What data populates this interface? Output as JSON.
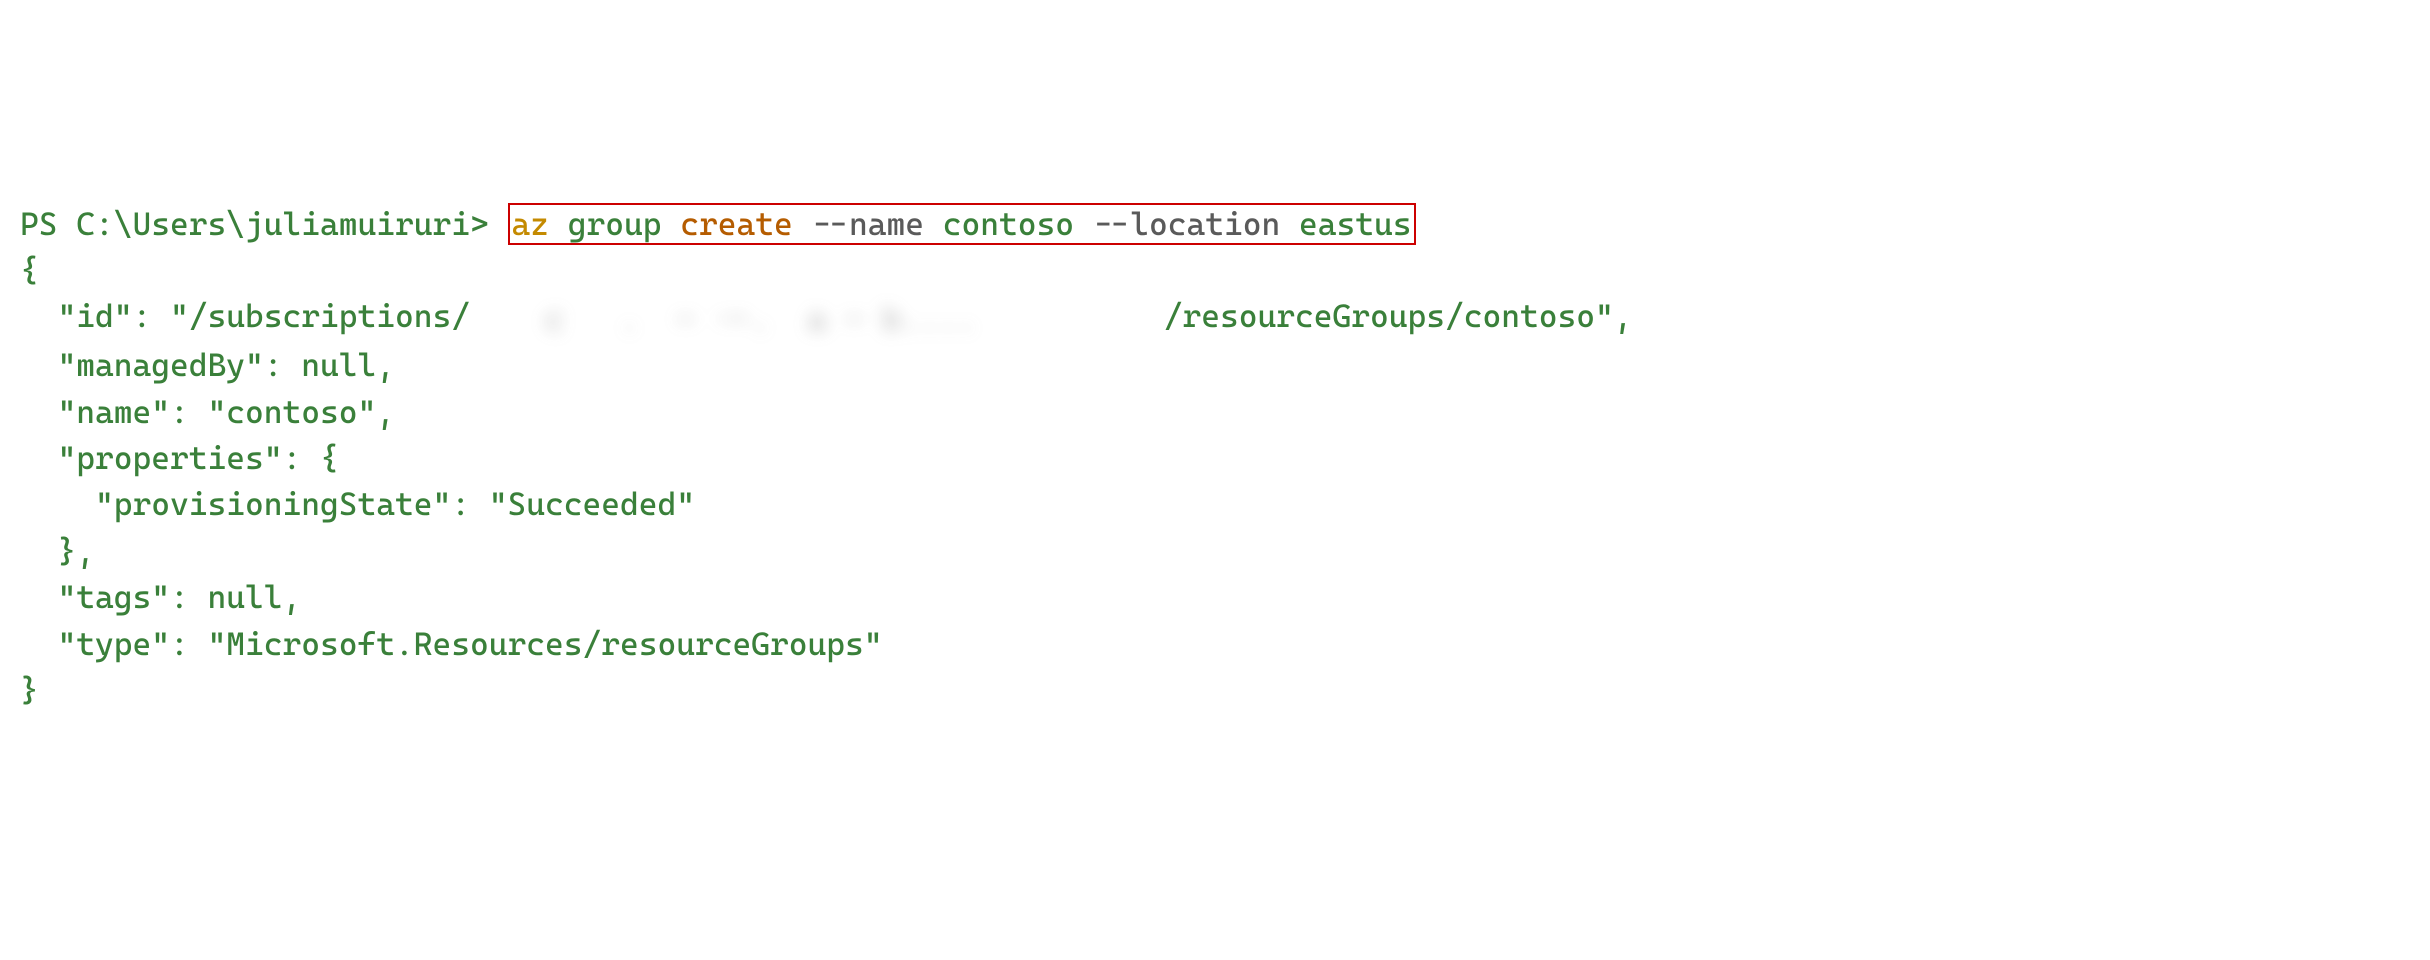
{
  "prompt": "PS C:\\Users\\juliamuiruri> ",
  "command": {
    "az": "az",
    "group": "group",
    "create": "create",
    "flag_name": "--name",
    "val_name": "contoso",
    "flag_loc": "--location",
    "val_loc": "eastus"
  },
  "output": {
    "open_brace": "{",
    "indent": "  ",
    "id_key": "\"id\": \"",
    "id_prefix": "/subscriptions/",
    "redacted_placeholder": "    c   .  - .-.  a - b....          ",
    "id_suffix": "/resourceGroups/contoso\",",
    "managedBy": "\"managedBy\": null,",
    "name": "\"name\": \"contoso\",",
    "properties_open": "\"properties\": {",
    "provisioningState": "\"provisioningState\": \"Succeeded\"",
    "properties_close": "},",
    "tags": "\"tags\": null,",
    "type": "\"type\": \"Microsoft.Resources/resourceGroups\"",
    "close_brace": "}"
  }
}
